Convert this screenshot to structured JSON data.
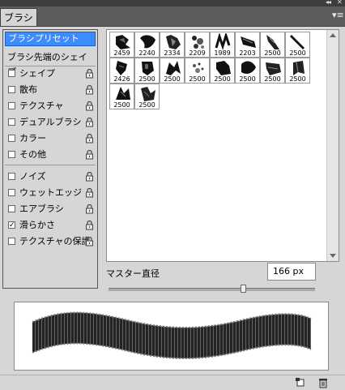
{
  "panel": {
    "tab_title": "ブラシ",
    "menu_icon": "panel-menu-icon"
  },
  "left": {
    "preset_label": "ブラシプリセット",
    "tip_shape_label": "ブラシ先端のシェイプ",
    "options": [
      {
        "label": "シェイプ",
        "checked": false
      },
      {
        "label": "散布",
        "checked": false
      },
      {
        "label": "テクスチャ",
        "checked": false
      },
      {
        "label": "デュアルブラシ",
        "checked": false
      },
      {
        "label": "カラー",
        "checked": false
      },
      {
        "label": "その他",
        "checked": false
      },
      {
        "label": "ノイズ",
        "checked": false
      },
      {
        "label": "ウェットエッジ",
        "checked": false
      },
      {
        "label": "エアブラシ",
        "checked": false
      },
      {
        "label": "滑らかさ",
        "checked": true
      },
      {
        "label": "テクスチャの保護",
        "checked": false
      }
    ]
  },
  "brushes": [
    "2459",
    "2240",
    "2334",
    "2209",
    "1989",
    "2203",
    "2500",
    "2500",
    "2426",
    "2500",
    "2500",
    "2500",
    "2500",
    "2500",
    "2500",
    "2500",
    "2500",
    "2500"
  ],
  "master": {
    "label": "マスター直径",
    "value": "166 px",
    "slider_fraction": 0.65
  }
}
